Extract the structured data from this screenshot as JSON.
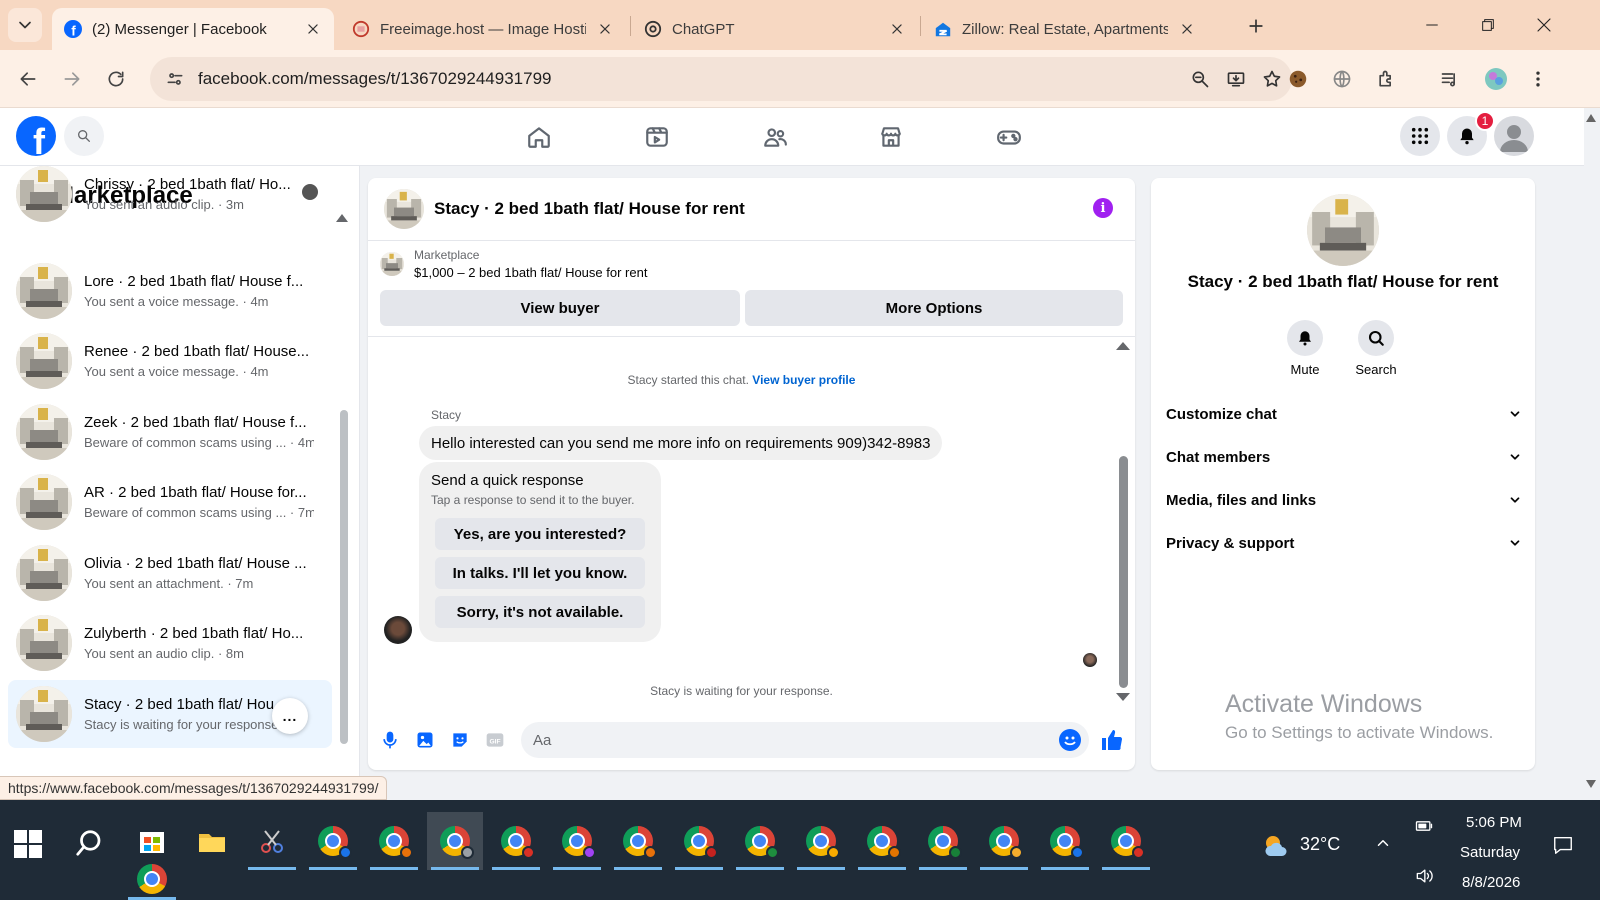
{
  "browser": {
    "tabs": [
      {
        "title": "(2) Messenger | Facebook",
        "active": true
      },
      {
        "title": "Freeimage.host — Image Hostin",
        "active": false
      },
      {
        "title": "ChatGPT",
        "active": false
      },
      {
        "title": "Zillow: Real Estate, Apartments,",
        "active": false
      }
    ],
    "url": "facebook.com/messages/t/1367029244931799",
    "status_url": "https://www.facebook.com/messages/t/1367029244931799/"
  },
  "fb": {
    "notification_count": "1",
    "brand_color": "#0866ff"
  },
  "marketplace": {
    "title": "Marketplace",
    "chats": [
      {
        "name": "Chrissy · 2 bed 1bath flat/ Ho...",
        "snippet": "You sent an audio clip. · 3m"
      },
      {
        "name": "Lore · 2 bed 1bath flat/ House f...",
        "snippet": "You sent a voice message. · 4m"
      },
      {
        "name": "Renee · 2 bed 1bath flat/ House...",
        "snippet": "You sent a voice message. · 4m"
      },
      {
        "name": "Zeek · 2 bed 1bath flat/ House f...",
        "snippet": "Beware of common scams using ...  · 4m"
      },
      {
        "name": "AR · 2 bed 1bath flat/ House for...",
        "snippet": "Beware of common scams using ...  · 7m"
      },
      {
        "name": "Olivia · 2 bed 1bath flat/ House ...",
        "snippet": "You sent an attachment. · 7m"
      },
      {
        "name": "Zulyberth · 2 bed 1bath flat/ Ho...",
        "snippet": "You sent an audio clip. · 8m"
      },
      {
        "name": "Stacy · 2 bed 1bath flat/ Hou...",
        "snippet": "Stacy is waiting for your response..."
      }
    ],
    "more_label": "..."
  },
  "conversation": {
    "title": "Stacy · 2 bed 1bath flat/ House for rent",
    "card_label": "Marketplace",
    "card_listing": "$1,000 – 2 bed 1bath flat/ House for rent",
    "view_buyer": "View buyer",
    "more_options": "More Options",
    "started_text": "Stacy started this chat.",
    "view_profile": "View buyer profile",
    "sender": "Stacy",
    "message": "Hello interested can you send me more info on requirements 909)342-8983",
    "quick_title": "Send a quick response",
    "quick_sub": "Tap a response to send it to the buyer.",
    "quick_options": [
      "Yes, are you interested?",
      "In talks. I'll let you know.",
      "Sorry, it's not available."
    ],
    "waiting": "Stacy is waiting for your response.",
    "input_placeholder": "Aa"
  },
  "details": {
    "name": "Stacy · 2 bed 1bath flat/ House for rent",
    "mute": "Mute",
    "search": "Search",
    "sections": [
      "Customize chat",
      "Chat members",
      "Media, files and links",
      "Privacy & support"
    ]
  },
  "watermark": {
    "line1": "Activate Windows",
    "line2": "Go to Settings to activate Windows."
  },
  "taskbar": {
    "temperature": "32°C",
    "time": "5:06 PM",
    "day": "Saturday",
    "date": "8/8/2026"
  }
}
